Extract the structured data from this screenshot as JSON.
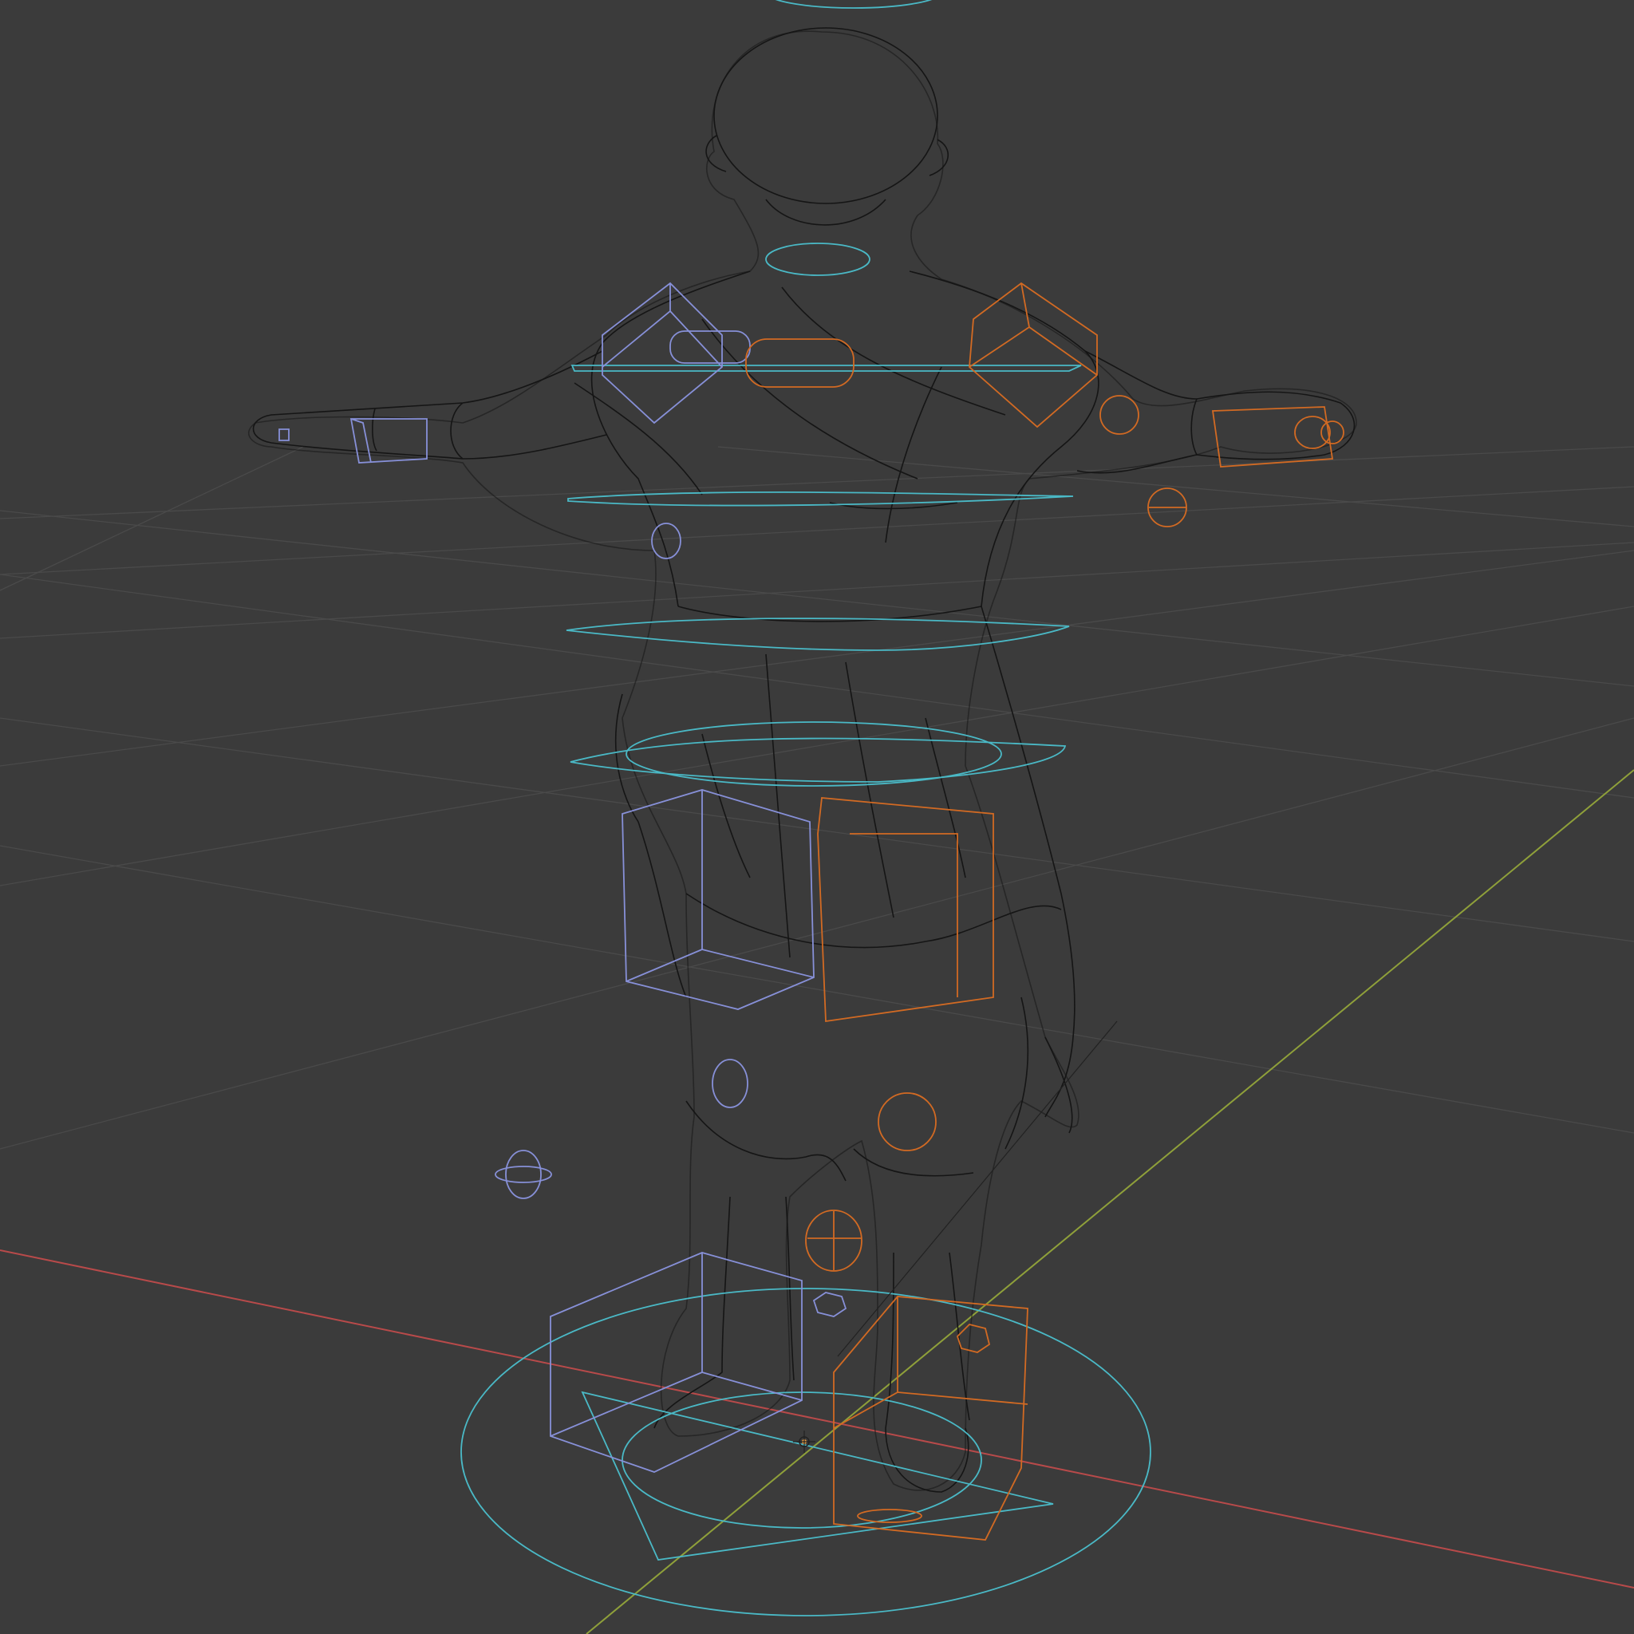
{
  "viewport": {
    "background": "#3b3b3b",
    "shading_mode": "wireframe",
    "grid_color": "#4a4a4a",
    "x_axis_color": "#b84a4a",
    "y_axis_color": "#8fa03a",
    "mesh_wire_color": "#151515"
  },
  "rig_controls": {
    "center_color": "#4ab9c6",
    "left_color": "#8790d8",
    "right_color": "#d26a23"
  },
  "icons": {
    "origin": "origin-point-icon",
    "world_axis_x": "x-axis-line",
    "world_axis_y": "y-axis-line"
  }
}
